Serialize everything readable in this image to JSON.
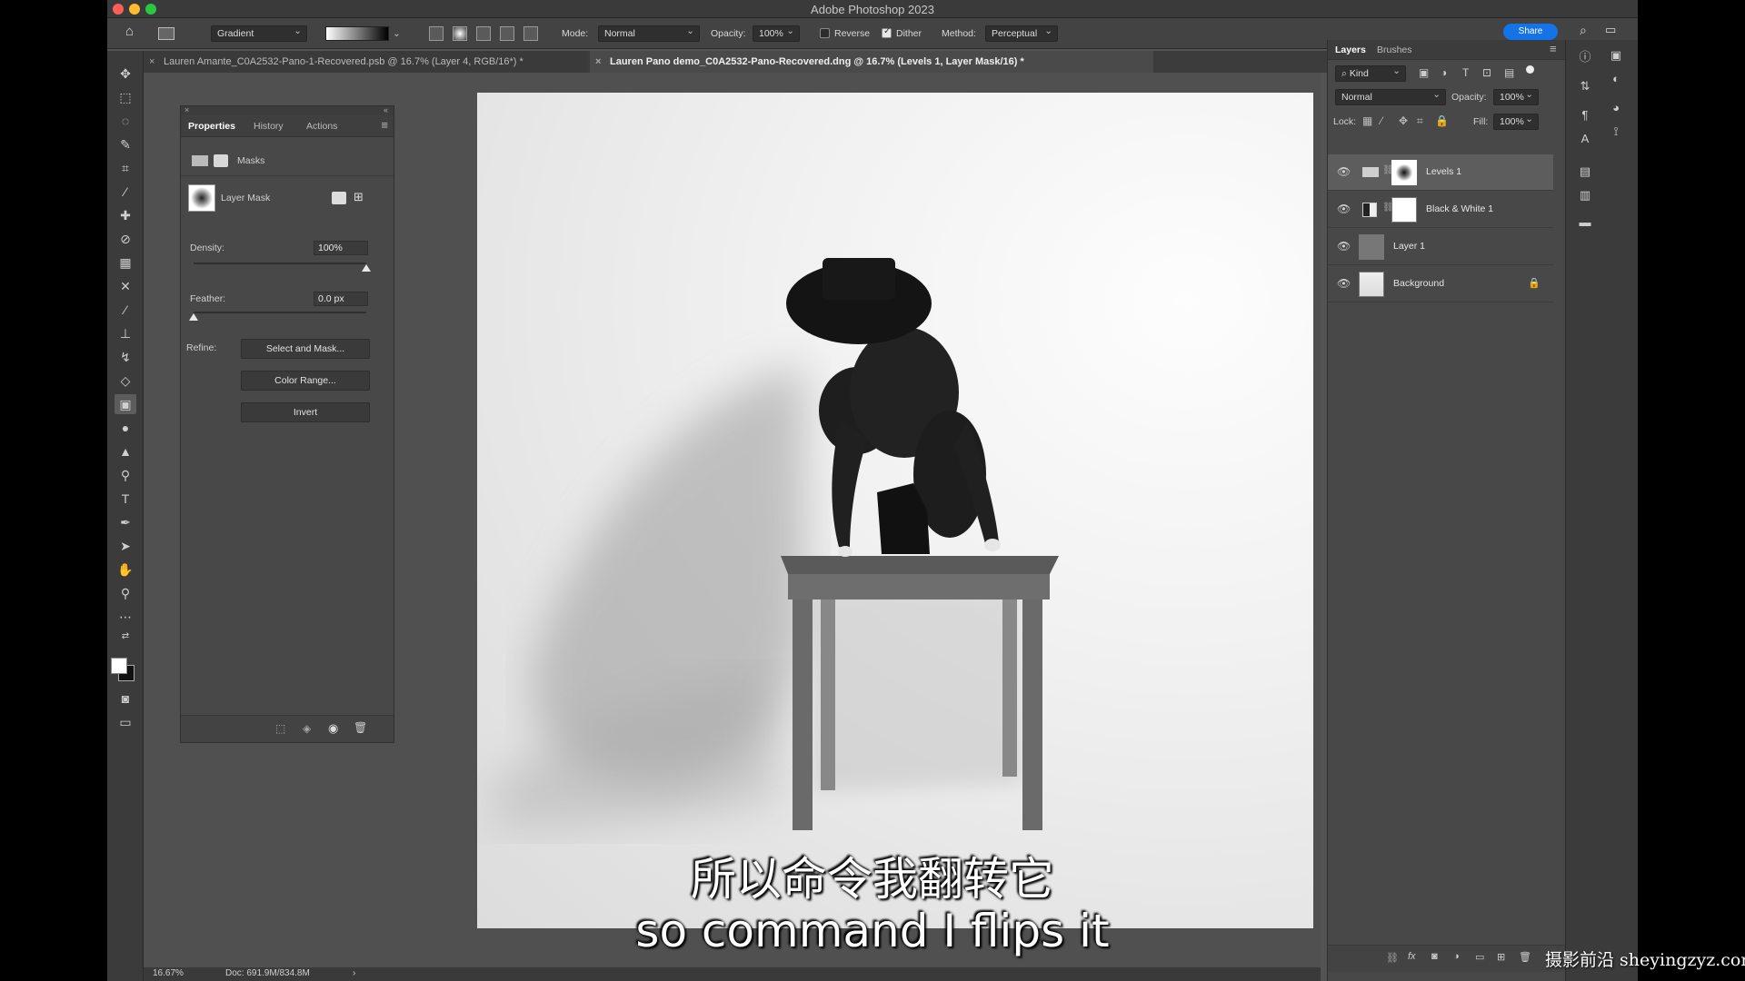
{
  "window": {
    "title": "Adobe Photoshop 2023"
  },
  "options_bar": {
    "preset": "Gradient",
    "mode_label": "Mode:",
    "mode_value": "Normal",
    "opacity_label": "Opacity:",
    "opacity_value": "100%",
    "reverse_label": "Reverse",
    "dither_label": "Dither",
    "method_label": "Method:",
    "method_value": "Perceptual",
    "share_label": "Share"
  },
  "tabs": [
    {
      "label": "Lauren Amante_C0A2532-Pano-1-Recovered.psb @ 16.7% (Layer 4, RGB/16*) *"
    },
    {
      "label": "Lauren Pano demo_C0A2532-Pano-Recovered.dng @ 16.7% (Levels 1, Layer Mask/16) *"
    }
  ],
  "properties": {
    "tabs": [
      "Properties",
      "History",
      "Actions"
    ],
    "masks_label": "Masks",
    "layer_mask_label": "Layer Mask",
    "density_label": "Density:",
    "density_value": "100%",
    "density_level": 100,
    "feather_label": "Feather:",
    "feather_value": "0.0 px",
    "feather_level": 0,
    "refine_label": "Refine:",
    "select_and_mask": "Select and Mask...",
    "color_range": "Color Range...",
    "invert": "Invert"
  },
  "layers": {
    "tabs": [
      "Layers",
      "Brushes"
    ],
    "kind_label": "Kind",
    "blend_mode": "Normal",
    "opacity_label": "Opacity:",
    "opacity_value": "100%",
    "lock_label": "Lock:",
    "fill_label": "Fill:",
    "fill_value": "100%",
    "items": [
      {
        "name": "Levels 1"
      },
      {
        "name": "Black & White 1"
      },
      {
        "name": "Layer 1"
      },
      {
        "name": "Background"
      }
    ]
  },
  "status": {
    "zoom": "16.67%",
    "doc": "Doc: 691.9M/834.8M"
  },
  "subtitles": {
    "zh": "所以命令我翻转它",
    "en": "so command I flips it"
  },
  "watermark": "摄影前沿 sheyingzyz.com",
  "colors": {
    "accent": "#1473e6",
    "panel": "#484848",
    "app_bg": "#535353"
  }
}
